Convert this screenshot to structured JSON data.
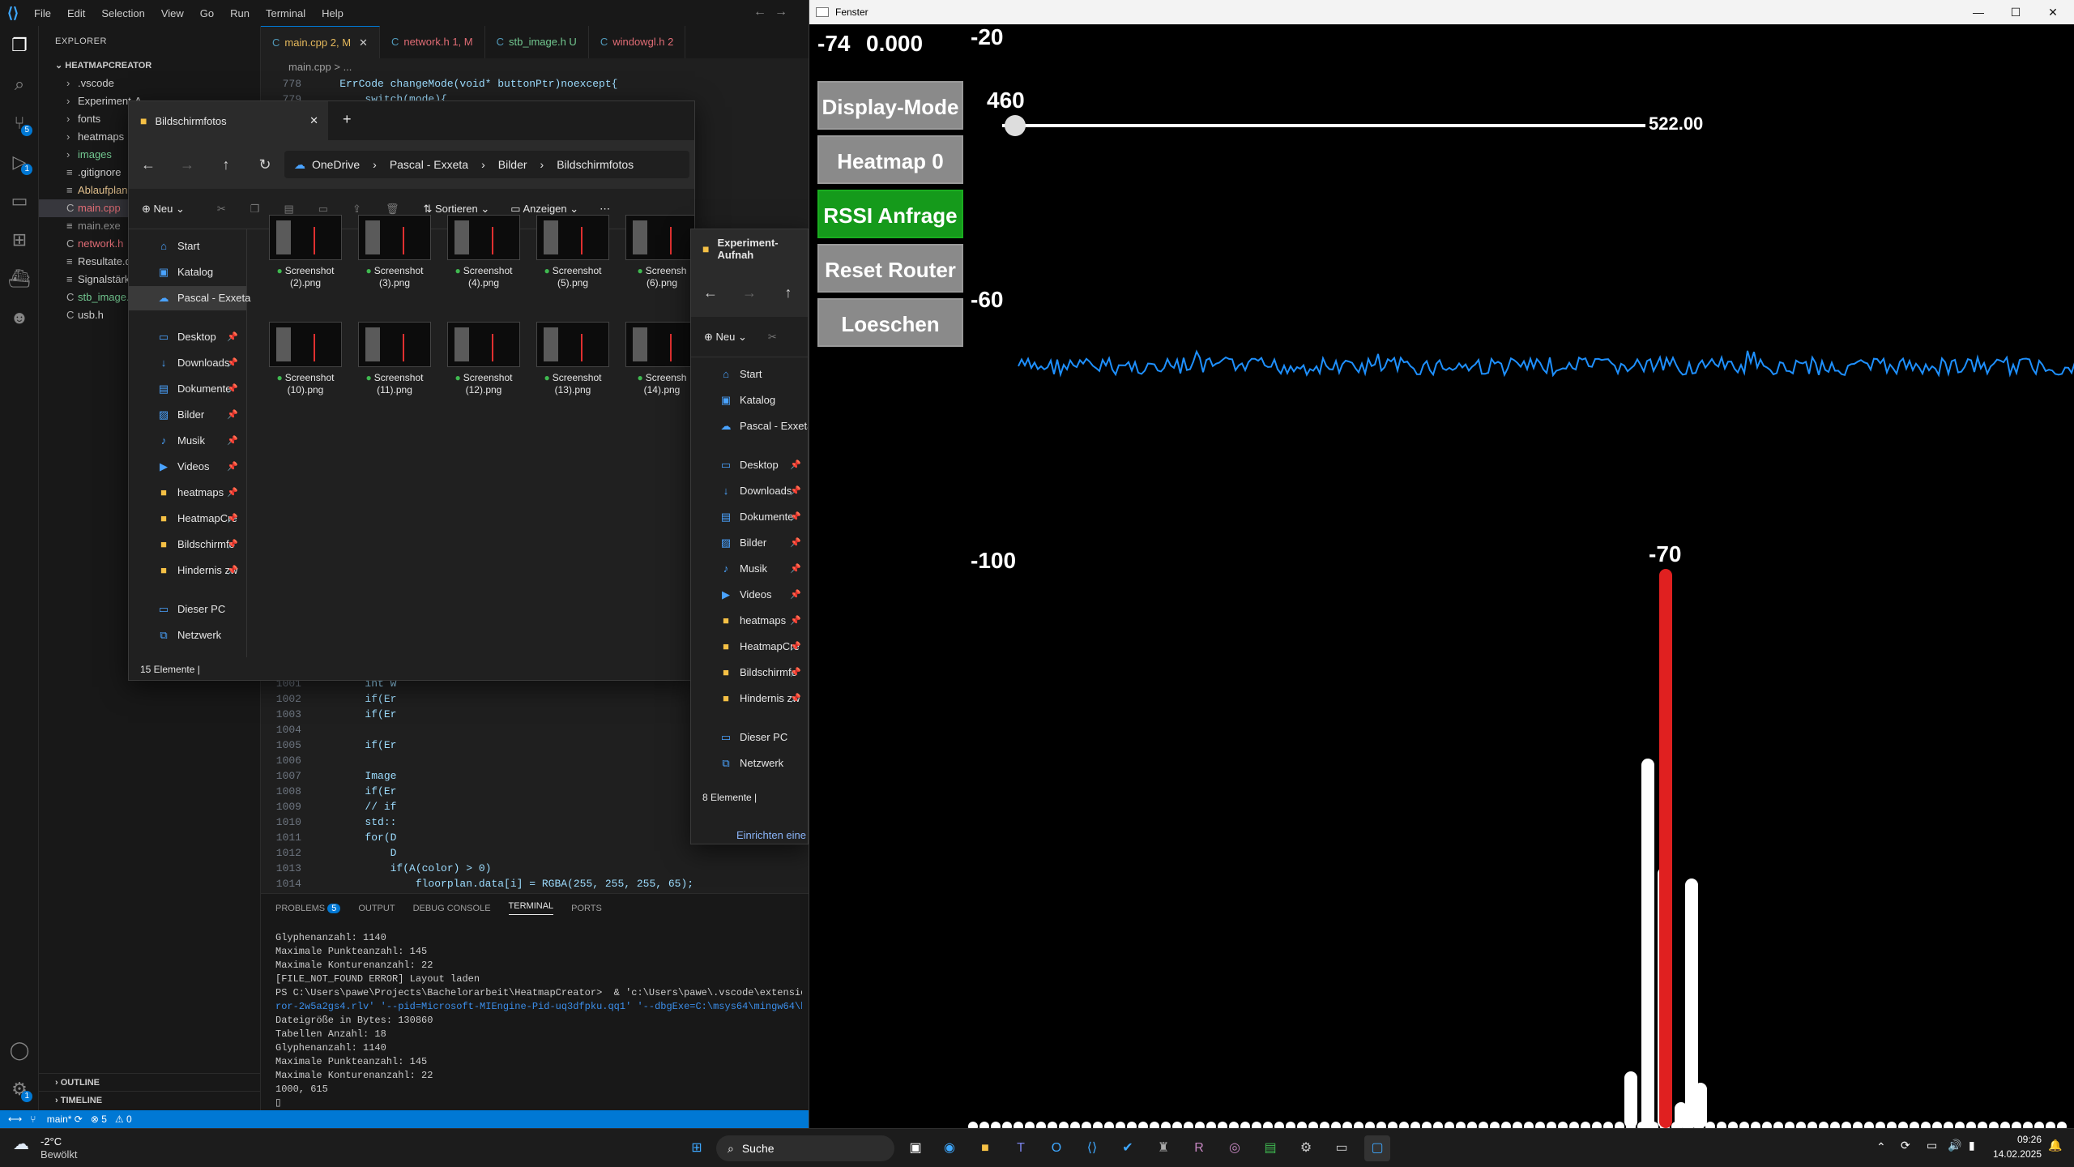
{
  "vscode": {
    "menu": [
      "File",
      "Edit",
      "Selection",
      "View",
      "Go",
      "Run",
      "Terminal",
      "Help"
    ],
    "explorer_title": "EXPLORER",
    "project": "HEATMAPCREATOR",
    "files": [
      {
        "name": ".vscode",
        "color": "#cccccc",
        "folder": true
      },
      {
        "name": "Experiment-A",
        "color": "#cccccc",
        "folder": true
      },
      {
        "name": "fonts",
        "color": "#cccccc",
        "folder": true
      },
      {
        "name": "heatmaps",
        "color": "#cccccc",
        "folder": true
      },
      {
        "name": "images",
        "color": "#73c991",
        "folder": true
      },
      {
        "name": ".gitignore",
        "color": "#cccccc",
        "folder": false
      },
      {
        "name": "Ablaufplan.txt",
        "color": "#e2c08d",
        "folder": false
      },
      {
        "name": "main.cpp",
        "color": "#e06c75",
        "folder": false
      },
      {
        "name": "main.exe",
        "color": "#8b8b8b",
        "folder": false
      },
      {
        "name": "network.h",
        "color": "#e06c75",
        "folder": false
      },
      {
        "name": "Resultate.doc",
        "color": "#cccccc",
        "folder": false
      },
      {
        "name": "Signalstärken",
        "color": "#cccccc",
        "folder": false
      },
      {
        "name": "stb_image.h",
        "color": "#73c991",
        "folder": false
      },
      {
        "name": "usb.h",
        "color": "#cccccc",
        "folder": false
      }
    ],
    "outline": "OUTLINE",
    "timeline": "TIMELINE",
    "tabs": [
      {
        "label": "main.cpp 2, M",
        "color": "#e5b95c",
        "active": true
      },
      {
        "label": "network.h 1, M",
        "color": "#e06c75",
        "active": false
      },
      {
        "label": "stb_image.h U",
        "color": "#73c991",
        "active": false
      },
      {
        "label": "windowgl.h 2",
        "color": "#e06c75",
        "active": false
      }
    ],
    "breadcrumb": "main.cpp > ...",
    "code_top": [
      {
        "ln": "778",
        "text": "    ErrCode changeMode(void* buttonPtr)noexcept{"
      },
      {
        "ln": "779",
        "text": "        switch(mode){"
      }
    ],
    "code_bottom": [
      {
        "ln": "1001",
        "text": "        int w"
      },
      {
        "ln": "1002",
        "text": "        if(Er"
      },
      {
        "ln": "1003",
        "text": "        if(Er"
      },
      {
        "ln": "1004",
        "text": ""
      },
      {
        "ln": "1005",
        "text": "        if(Er"
      },
      {
        "ln": "1006",
        "text": ""
      },
      {
        "ln": "1007",
        "text": "        Image"
      },
      {
        "ln": "1008",
        "text": "        if(Er"
      },
      {
        "ln": "1009",
        "text": "        // if"
      },
      {
        "ln": "1010",
        "text": "        std::"
      },
      {
        "ln": "1011",
        "text": "        for(D"
      },
      {
        "ln": "1012",
        "text": "            D"
      },
      {
        "ln": "1013",
        "text": "            if(A(color) > 0)"
      },
      {
        "ln": "1014",
        "text": "                floorplan.data[i] = RGBA(255, 255, 255, 65);"
      }
    ],
    "panel_tabs": [
      "PROBLEMS",
      "OUTPUT",
      "DEBUG CONSOLE",
      "TERMINAL",
      "PORTS"
    ],
    "problems_count": "5",
    "terminal": [
      "Glyphenanzahl: 1140",
      "Maximale Punkteanzahl: 145",
      "Maximale Konturenanzahl: 22",
      "[FILE_NOT_FOUND ERROR] Layout laden",
      "PS C:\\Users\\pawe\\Projects\\Bachelorarbeit\\HeatmapCreator>  & 'c:\\Users\\pawe\\.vscode\\extensions\\",
      "ror-2w5a2gs4.rlv' '--pid=Microsoft-MIEngine-Pid-uq3dfpku.qq1' '--dbgExe=C:\\msys64\\mingw64\\bin\\",
      "Dateigröße in Bytes: 130860",
      "Tabellen Anzahl: 18",
      "Glyphenanzahl: 1140",
      "Maximale Punkteanzahl: 145",
      "Maximale Konturenanzahl: 22",
      "1000, 615",
      "▯"
    ],
    "status": {
      "branch": "main*",
      "errors": "⊗ 5",
      "warnings": "⚠ 0"
    }
  },
  "explorer1": {
    "tab_title": "Bildschirmfotos",
    "path": [
      "OneDrive",
      "Pascal - Exxeta",
      "Bilder",
      "Bildschirmfotos"
    ],
    "new_label": "Neu",
    "sort_label": "Sortieren",
    "view_label": "Anzeigen",
    "nav": [
      {
        "label": "Start",
        "icon": "⌂",
        "pin": false
      },
      {
        "label": "Katalog",
        "icon": "▣",
        "pin": false
      },
      {
        "label": "Pascal - Exxeta",
        "icon": "☁",
        "pin": false,
        "sel": true
      },
      {
        "label": "Desktop",
        "icon": "▭",
        "pin": true
      },
      {
        "label": "Downloads",
        "icon": "↓",
        "pin": true
      },
      {
        "label": "Dokumente",
        "icon": "▤",
        "pin": true
      },
      {
        "label": "Bilder",
        "icon": "▨",
        "pin": true
      },
      {
        "label": "Musik",
        "icon": "♪",
        "pin": true
      },
      {
        "label": "Videos",
        "icon": "▶",
        "pin": true
      },
      {
        "label": "heatmaps",
        "icon": "■",
        "pin": true
      },
      {
        "label": "HeatmapCre",
        "icon": "■",
        "pin": true
      },
      {
        "label": "Bildschirmfo",
        "icon": "■",
        "pin": true
      },
      {
        "label": "Hindernis zw",
        "icon": "■",
        "pin": true
      },
      {
        "label": "Dieser PC",
        "icon": "▭",
        "pin": false
      },
      {
        "label": "Netzwerk",
        "icon": "⧉",
        "pin": false
      }
    ],
    "thumbs": [
      [
        "Screenshot",
        "(2).png"
      ],
      [
        "Screenshot",
        "(3).png"
      ],
      [
        "Screenshot",
        "(4).png"
      ],
      [
        "Screenshot",
        "(5).png"
      ],
      [
        "Screensh",
        "(6).png"
      ],
      [
        "Screenshot",
        "(10).png"
      ],
      [
        "Screenshot",
        "(11).png"
      ],
      [
        "Screenshot",
        "(12).png"
      ],
      [
        "Screenshot",
        "(13).png"
      ],
      [
        "Screensh",
        "(14).png"
      ]
    ],
    "status": "15 Elemente"
  },
  "explorer2": {
    "tab_title": "Experiment-Aufnah",
    "new_label": "Neu",
    "nav": [
      {
        "label": "Start",
        "icon": "⌂",
        "pin": false
      },
      {
        "label": "Katalog",
        "icon": "▣",
        "pin": false
      },
      {
        "label": "Pascal - Exxeta",
        "icon": "☁",
        "pin": false
      },
      {
        "label": "Desktop",
        "icon": "▭",
        "pin": true
      },
      {
        "label": "Downloads",
        "icon": "↓",
        "pin": true
      },
      {
        "label": "Dokumente",
        "icon": "▤",
        "pin": true
      },
      {
        "label": "Bilder",
        "icon": "▨",
        "pin": true
      },
      {
        "label": "Musik",
        "icon": "♪",
        "pin": true
      },
      {
        "label": "Videos",
        "icon": "▶",
        "pin": true
      },
      {
        "label": "heatmaps",
        "icon": "■",
        "pin": true
      },
      {
        "label": "HeatmapCre",
        "icon": "■",
        "pin": true
      },
      {
        "label": "Bildschirmfo",
        "icon": "■",
        "pin": true
      },
      {
        "label": "Hindernis zw",
        "icon": "■",
        "pin": true
      },
      {
        "label": "Dieser PC",
        "icon": "▭",
        "pin": false
      },
      {
        "label": "Netzwerk",
        "icon": "⧉",
        "pin": false
      }
    ],
    "status": "8 Elemente",
    "setup_link": "Einrichten eine"
  },
  "fenster": {
    "title": "Fenster",
    "value_left": "-74",
    "value_right": "0.000",
    "buttons": [
      {
        "label": "Display-Mode",
        "green": false
      },
      {
        "label": "Heatmap 0",
        "green": false
      },
      {
        "label": "RSSI Anfrage",
        "green": true
      },
      {
        "label": "Reset Router",
        "green": false
      },
      {
        "label": "Loeschen",
        "green": false
      }
    ],
    "axis_top": "-20",
    "axis_mid": "-60",
    "axis_bottom": "-100",
    "slider_value": "460",
    "slider_max": "522.00",
    "slider_fraction": 0.02,
    "peak_label": "-70",
    "line_color": "#1e90ff",
    "peak_color": "#e02020"
  },
  "taskbar": {
    "weather_temp": "-2°C",
    "weather_text": "Bewölkt",
    "search": "Suche",
    "time": "09:26",
    "date": "14.02.2025"
  }
}
